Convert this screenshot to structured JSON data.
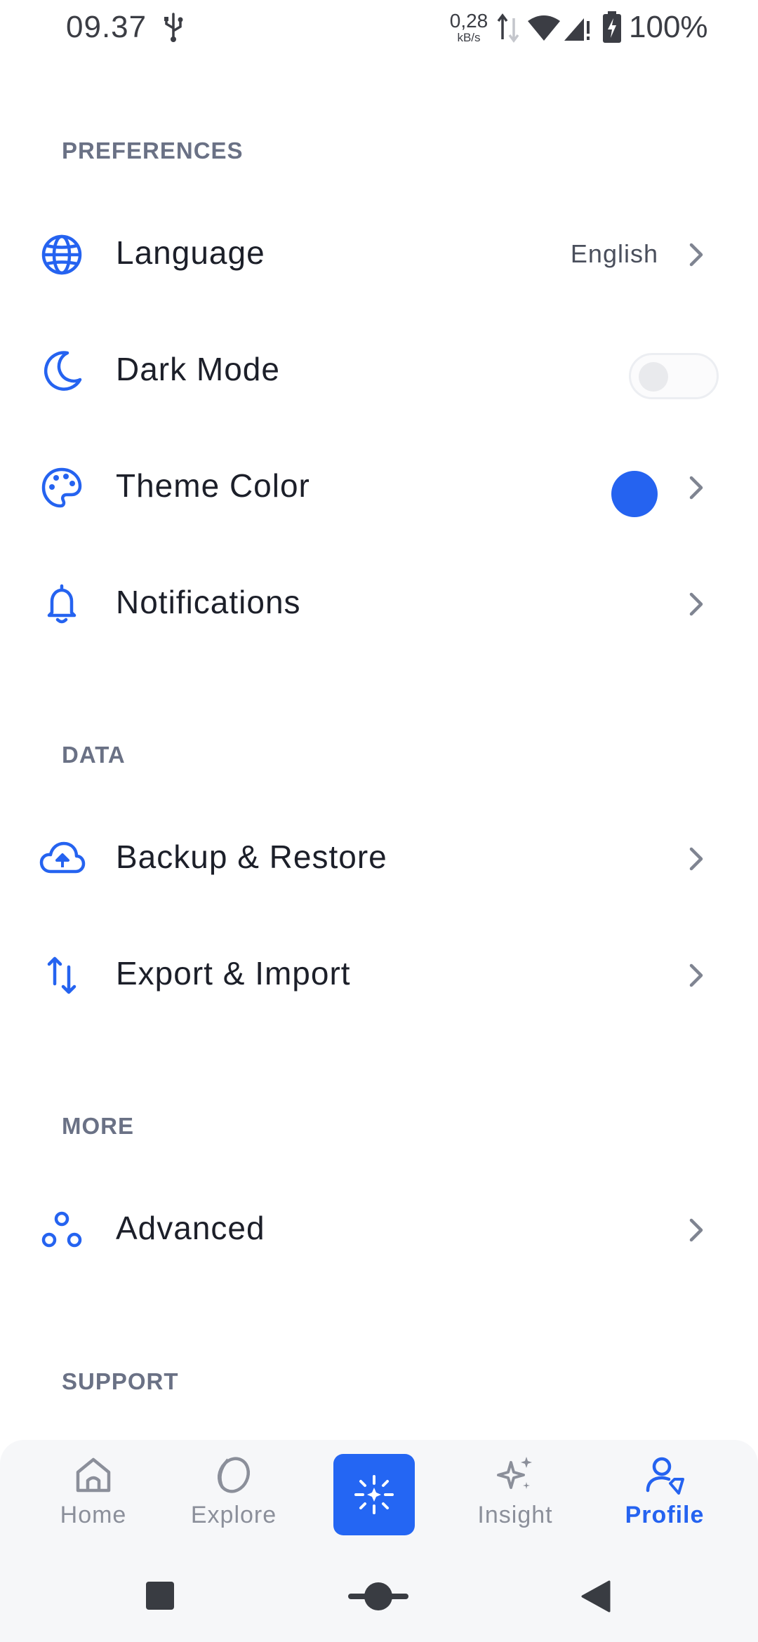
{
  "status_bar": {
    "time": "09.37",
    "net_speed_value": "0,28",
    "net_speed_unit": "kB/s",
    "battery": "100%"
  },
  "sections": {
    "preferences": "PREFERENCES",
    "data": "DATA",
    "more": "MORE",
    "support": "SUPPORT"
  },
  "rows": {
    "language": {
      "label": "Language",
      "value": "English",
      "icon": "globe-icon"
    },
    "dark_mode": {
      "label": "Dark Mode",
      "enabled": false,
      "icon": "moon-icon"
    },
    "theme_color": {
      "label": "Theme Color",
      "color": "#2563f0",
      "icon": "palette-icon"
    },
    "notifications": {
      "label": "Notifications",
      "icon": "bell-icon"
    },
    "backup": {
      "label": "Backup & Restore",
      "icon": "cloud-upload-icon"
    },
    "export": {
      "label": "Export & Import",
      "icon": "transfer-arrows-icon"
    },
    "advanced": {
      "label": "Advanced",
      "icon": "circles-icon"
    }
  },
  "bottom_nav": {
    "home": "Home",
    "explore": "Explore",
    "insight": "Insight",
    "profile": "Profile",
    "active": "profile"
  },
  "colors": {
    "accent": "#2563f0",
    "section_title": "#6a7185",
    "inactive_nav": "#8b8f9a"
  }
}
